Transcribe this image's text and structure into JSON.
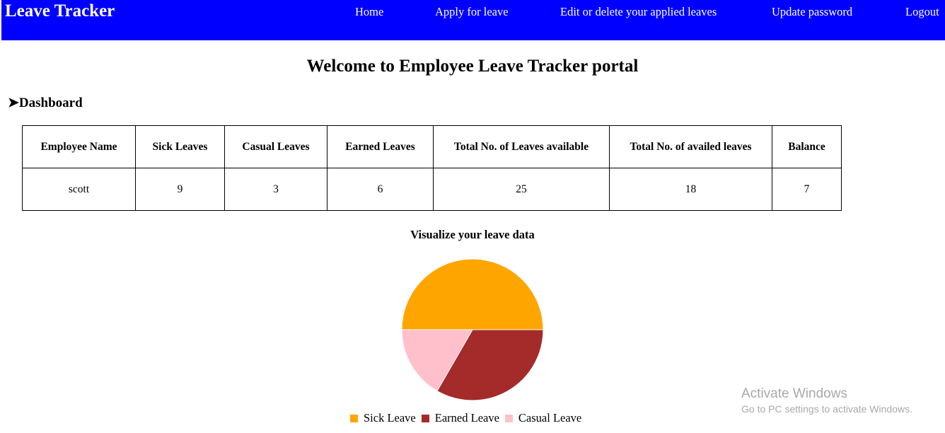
{
  "navbar": {
    "brand": "Leave Tracker",
    "links": [
      "Home",
      "Apply for leave",
      "Edit or delete your applied leaves",
      "Update password",
      "Logout"
    ],
    "background_color": "#0000ff"
  },
  "page": {
    "heading": "Welcome to Employee Leave Tracker portal",
    "section_icon": "➤",
    "section_title": "Dashboard"
  },
  "table": {
    "headers": [
      "Employee Name",
      "Sick Leaves",
      "Casual Leaves",
      "Earned Leaves",
      "Total No. of Leaves available",
      "Total No. of availed leaves",
      "Balance"
    ],
    "rows": [
      [
        "scott",
        "9",
        "3",
        "6",
        "25",
        "18",
        "7"
      ]
    ]
  },
  "visualization": {
    "title": "Visualize your leave data"
  },
  "chart_data": {
    "type": "pie",
    "labels": [
      "Sick Leave",
      "Earned Leave",
      "Casual Leave"
    ],
    "values": [
      9,
      6,
      3
    ],
    "colors": [
      "#ffa500",
      "#a52a2a",
      "#ffc0cb"
    ],
    "legend_position": "bottom"
  },
  "watermark": {
    "title": "Activate Windows",
    "subtitle": "Go to PC settings to activate Windows."
  }
}
